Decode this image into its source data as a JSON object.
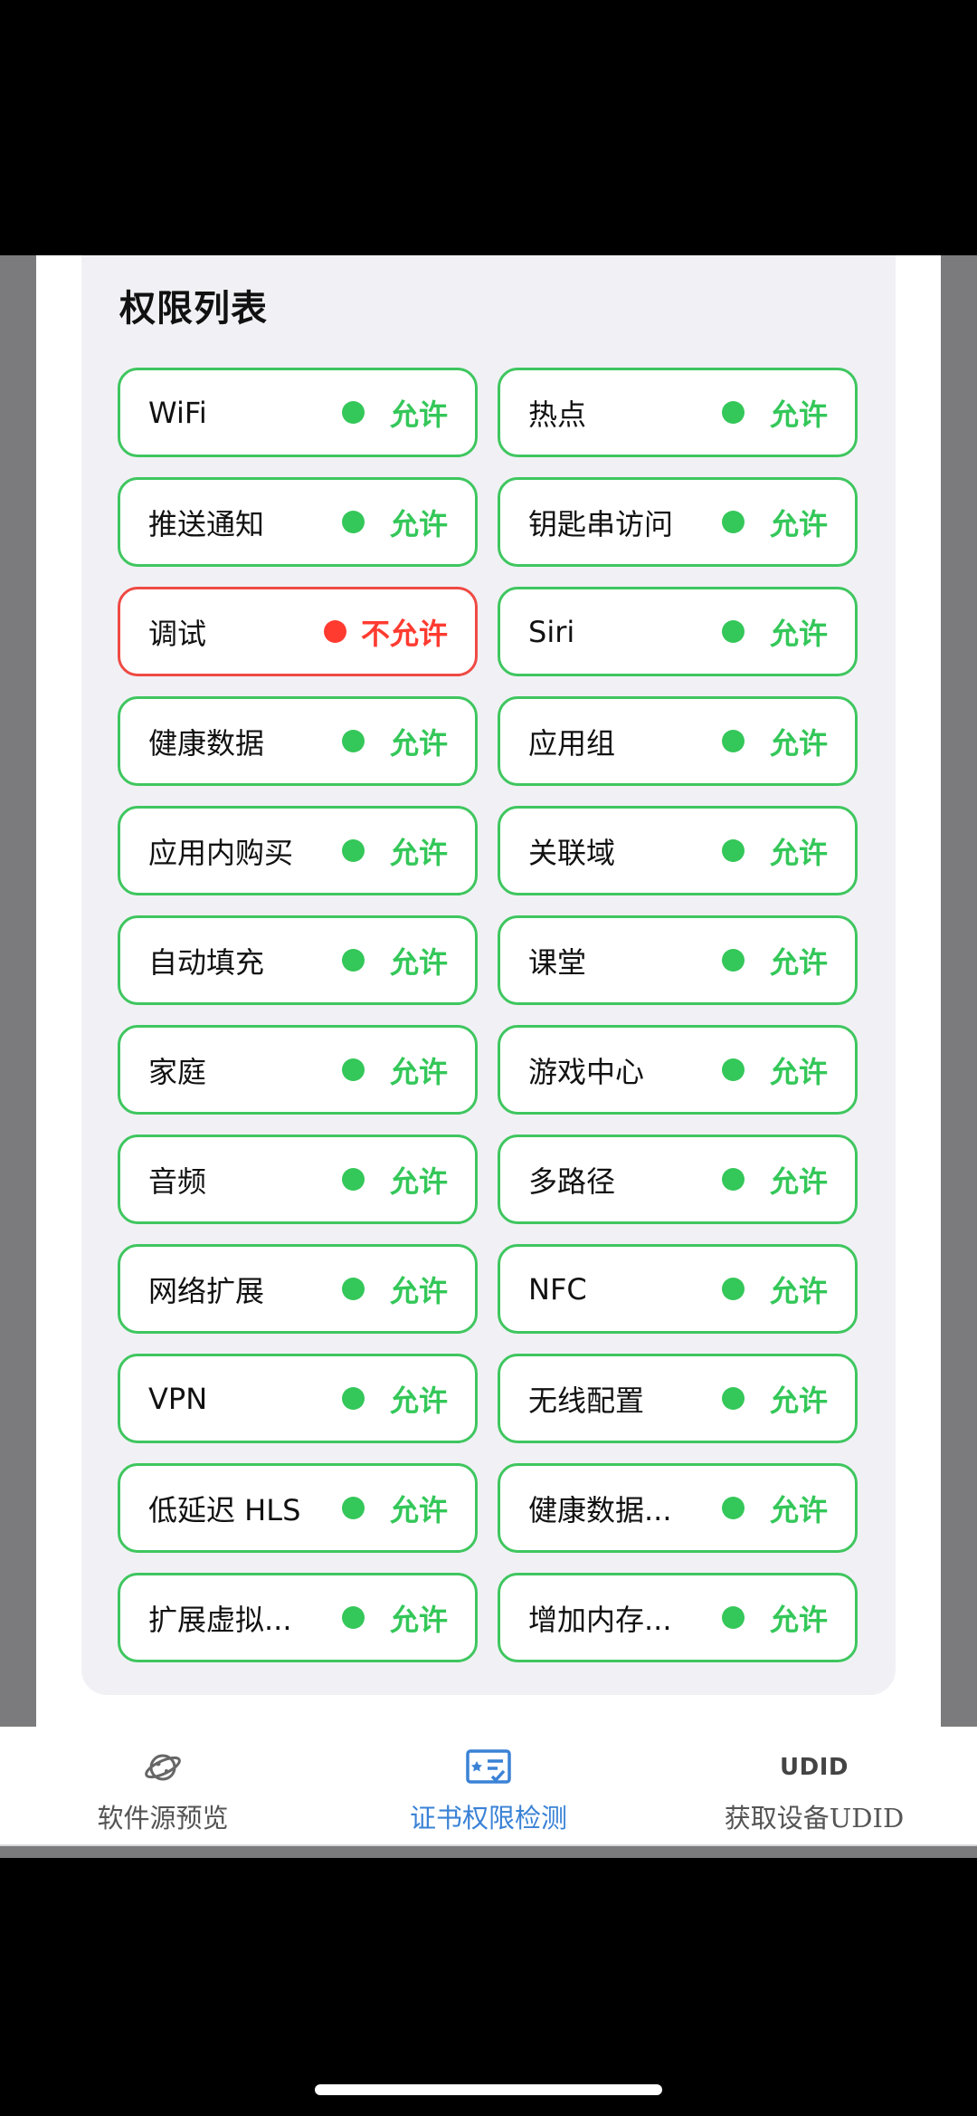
{
  "card": {
    "title": "权限列表"
  },
  "permissions": [
    {
      "name": "WiFi",
      "status": "允许",
      "allowed": true
    },
    {
      "name": "热点",
      "status": "允许",
      "allowed": true
    },
    {
      "name": "推送通知",
      "status": "允许",
      "allowed": true
    },
    {
      "name": "钥匙串访问",
      "status": "允许",
      "allowed": true
    },
    {
      "name": "调试",
      "status": "不允许",
      "allowed": false
    },
    {
      "name": "Siri",
      "status": "允许",
      "allowed": true
    },
    {
      "name": "健康数据",
      "status": "允许",
      "allowed": true
    },
    {
      "name": "应用组",
      "status": "允许",
      "allowed": true
    },
    {
      "name": "应用内购买",
      "status": "允许",
      "allowed": true
    },
    {
      "name": "关联域",
      "status": "允许",
      "allowed": true
    },
    {
      "name": "自动填充",
      "status": "允许",
      "allowed": true
    },
    {
      "name": "课堂",
      "status": "允许",
      "allowed": true
    },
    {
      "name": "家庭",
      "status": "允许",
      "allowed": true
    },
    {
      "name": "游戏中心",
      "status": "允许",
      "allowed": true
    },
    {
      "name": "音频",
      "status": "允许",
      "allowed": true
    },
    {
      "name": "多路径",
      "status": "允许",
      "allowed": true
    },
    {
      "name": "网络扩展",
      "status": "允许",
      "allowed": true
    },
    {
      "name": "NFC",
      "status": "允许",
      "allowed": true
    },
    {
      "name": "VPN",
      "status": "允许",
      "allowed": true
    },
    {
      "name": "无线配置",
      "status": "允许",
      "allowed": true
    },
    {
      "name": "低延迟 HLS",
      "status": "允许",
      "allowed": true
    },
    {
      "name": "健康数据...",
      "status": "允许",
      "allowed": true
    },
    {
      "name": "扩展虚拟...",
      "status": "允许",
      "allowed": true
    },
    {
      "name": "增加内存...",
      "status": "允许",
      "allowed": true
    }
  ],
  "tabbar": {
    "tabs": [
      {
        "label": "软件源预览",
        "icon": "planet-icon",
        "active": false
      },
      {
        "label": "证书权限检测",
        "icon": "certificate-icon",
        "active": true
      },
      {
        "label": "获取设备UDID",
        "icon": "udid-icon",
        "icon_text": "UDID",
        "active": false
      }
    ]
  },
  "colors": {
    "allowed": "#34c759",
    "denied": "#ff3b30",
    "active_tab": "#3a82d6"
  }
}
